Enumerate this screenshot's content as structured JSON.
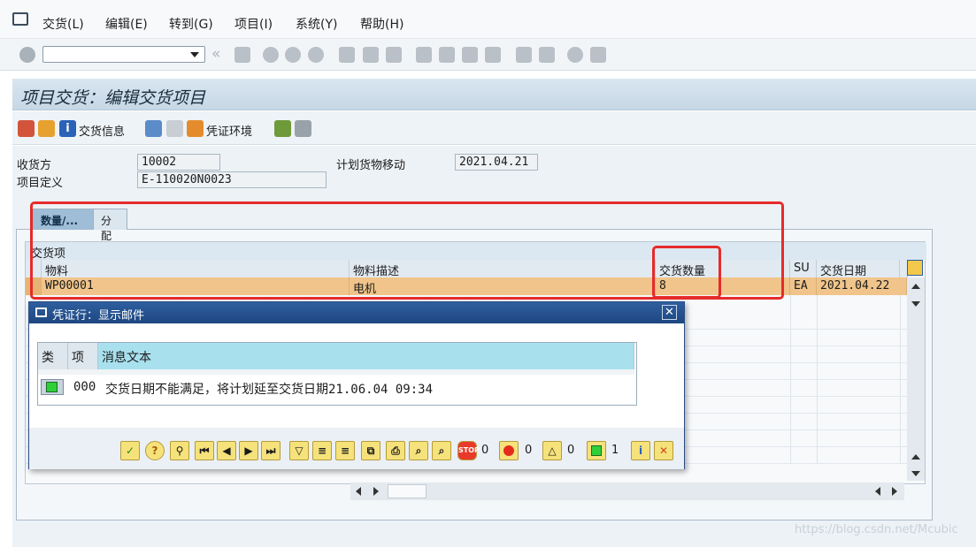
{
  "menu": [
    "交货(L)",
    "编辑(E)",
    "转到(G)",
    "项目(I)",
    "系统(Y)",
    "帮助(H)"
  ],
  "page_title": "项目交货：编辑交货项目",
  "app_toolbar": {
    "delivery_info_label": "交货信息",
    "document_env_label": "凭证环境"
  },
  "header": {
    "recipient_label": "收货方",
    "recipient_value": "10002",
    "project_def_label": "项目定义",
    "project_def_value": "E-110020N0023",
    "planned_move_label": "计划货物移动",
    "planned_move_value": "2021.04.21"
  },
  "tabs": [
    {
      "label": "数量/...",
      "active": true
    },
    {
      "label": "分配",
      "active": false
    }
  ],
  "grid": {
    "title": "交货项",
    "columns": [
      "物料",
      "物料描述",
      "交货数量",
      "SU",
      "交货日期"
    ],
    "rows": [
      {
        "material": "WP00001",
        "description": "电机",
        "quantity": "8",
        "su": "EA",
        "date": "2021.04.22"
      }
    ]
  },
  "dialog": {
    "title": "凭证行：显示邮件",
    "close_label": "✕",
    "columns": [
      "类",
      "项",
      "消息文本"
    ],
    "message": {
      "item": "000",
      "text": "交货日期不能满足，将计划延至交货日期21.06.04 09:34"
    },
    "counts": {
      "stop": "0",
      "error": "0",
      "warning": "0",
      "success": "1"
    }
  },
  "watermark": "https://blog.csdn.net/Mcubic",
  "colors": {
    "title_bg": "#c6d7e5",
    "highlight_row": "#f0c48a",
    "dialog_title": "#1d4782",
    "annotation_red": "#e62b2b",
    "success_green": "#2fcf3a"
  }
}
